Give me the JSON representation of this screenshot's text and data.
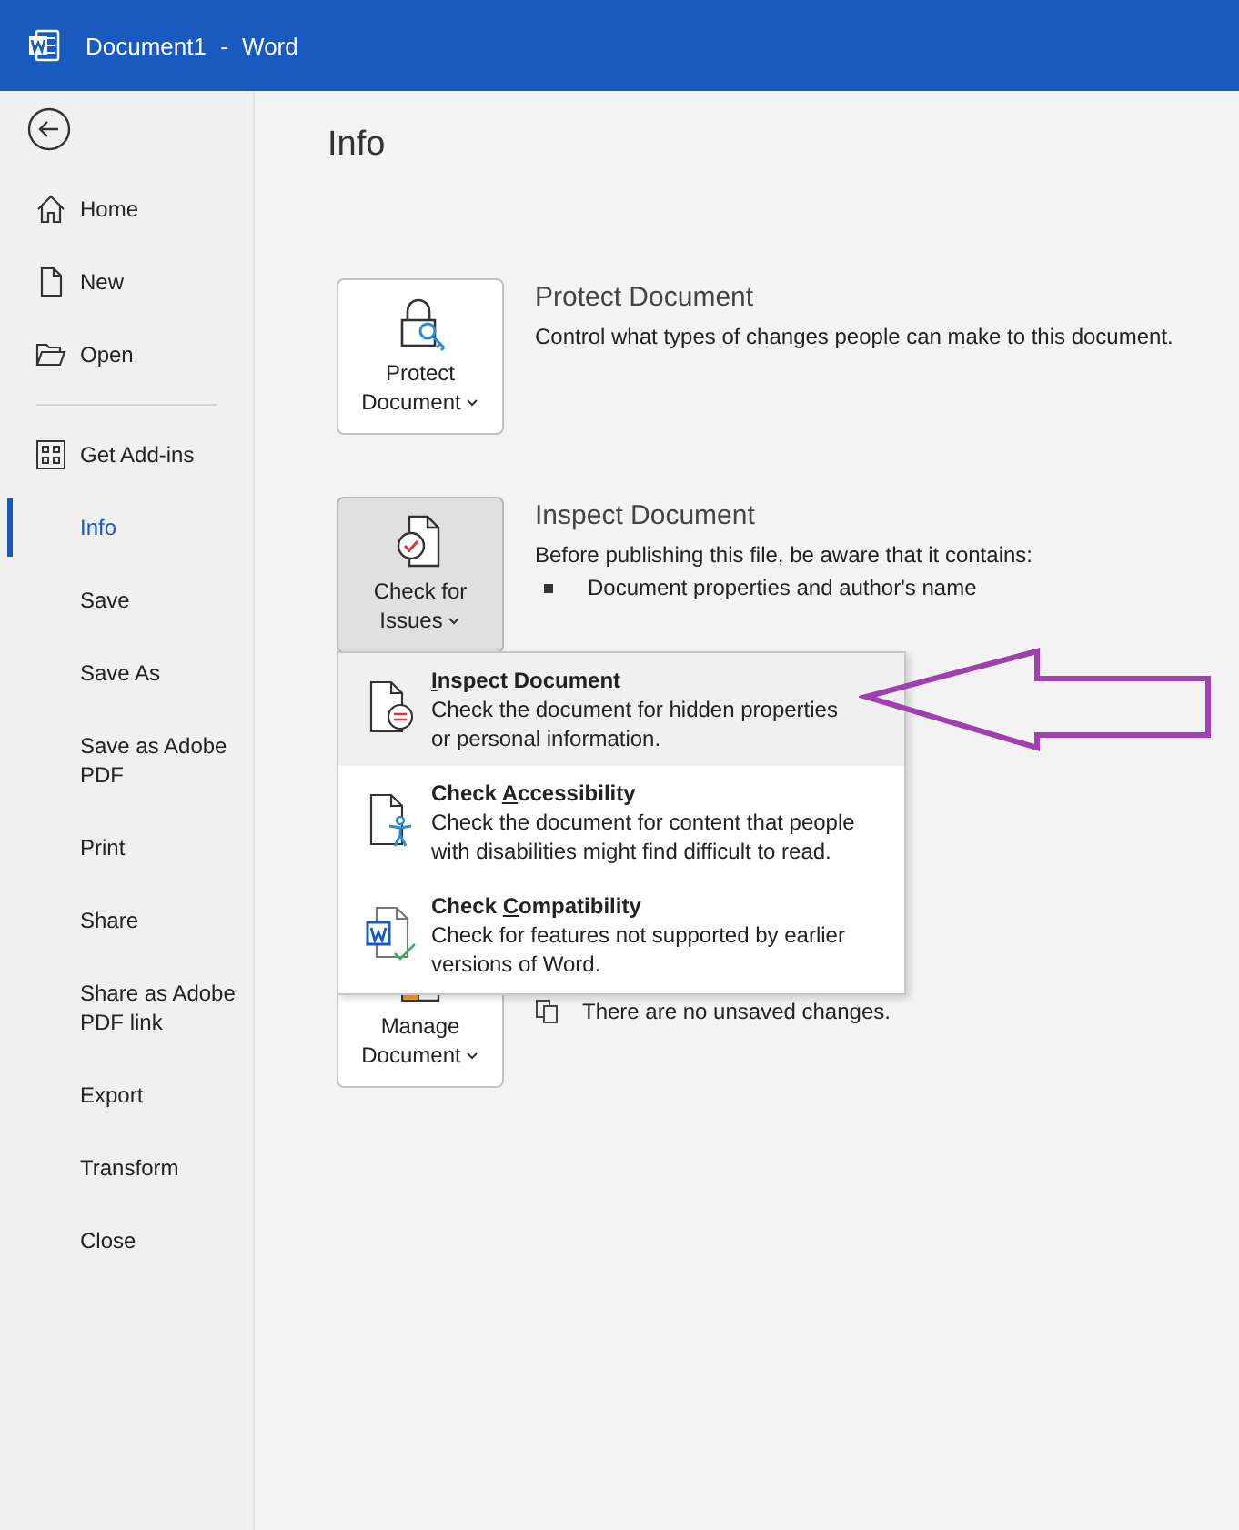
{
  "window": {
    "title": "Document1 - Word"
  },
  "sidebar": {
    "primary": [
      {
        "label": "Home",
        "kind": "home",
        "selected": false
      },
      {
        "label": "New",
        "kind": "page",
        "selected": false
      },
      {
        "label": "Open",
        "kind": "folder",
        "selected": false
      }
    ],
    "secondary": [
      {
        "label": "Get Add-ins",
        "kind": "grid",
        "selected": false
      },
      {
        "label": "Info",
        "kind": "text",
        "selected": true
      },
      {
        "label": "Save",
        "kind": "text",
        "selected": false
      },
      {
        "label": "Save As",
        "kind": "text",
        "selected": false
      },
      {
        "label": "Save as Adobe PDF",
        "kind": "text",
        "selected": false
      },
      {
        "label": "Print",
        "kind": "text",
        "selected": false
      },
      {
        "label": "Share",
        "kind": "text",
        "selected": false
      },
      {
        "label": "Share as Adobe PDF link",
        "kind": "text",
        "selected": false
      },
      {
        "label": "Export",
        "kind": "text",
        "selected": false
      },
      {
        "label": "Transform",
        "kind": "text",
        "selected": false
      },
      {
        "label": "Close",
        "kind": "text",
        "selected": false
      }
    ]
  },
  "page_title": "Info",
  "sections": [
    {
      "kind": "lock",
      "button": "Protect Document",
      "selected": false,
      "heading": "Protect Document",
      "description": "Control what types of changes people can make to this document."
    },
    {
      "kind": "check",
      "button": "Check for Issues",
      "selected": true,
      "heading": "Inspect Document",
      "description": "Before publishing this file, be aware that it contains:",
      "bullets": [
        "Document properties and author's name"
      ]
    },
    {
      "kind": "manage",
      "button": "Manage Document",
      "selected": false,
      "status": "There are no unsaved changes."
    }
  ],
  "menu": {
    "items": [
      {
        "kind": "inspect",
        "key": "I",
        "rest": "nspect Document",
        "description": "Check the document for hidden properties or personal information.",
        "selected": true
      },
      {
        "kind": "accessibility",
        "lead": "Check ",
        "key": "A",
        "rest": "ccessibility",
        "description": "Check the document for content that people with disabilities might find difficult to read.",
        "selected": false
      },
      {
        "kind": "compatibility",
        "lead": "Check ",
        "key": "C",
        "rest": "ompatibility",
        "description": "Check for features not supported by earlier versions of Word.",
        "selected": false
      }
    ]
  }
}
